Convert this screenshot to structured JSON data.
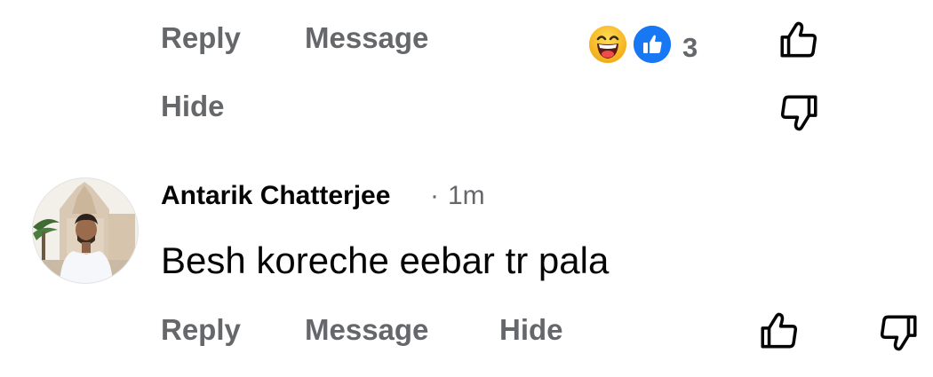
{
  "comment1": {
    "actions": {
      "reply": "Reply",
      "message": "Message",
      "hide": "Hide"
    },
    "reactions": {
      "icons": [
        "laughing-emoji-icon",
        "like-reaction-icon"
      ],
      "count": "3"
    }
  },
  "comment2": {
    "author": "Antarik Chatterjee",
    "separator": "·",
    "time": "1m",
    "text": "Besh koreche eebar tr pala",
    "actions": {
      "reply": "Reply",
      "message": "Message",
      "hide": "Hide"
    }
  },
  "colors": {
    "action_gray": "#65676b",
    "text_black": "#050505",
    "like_blue": "#1877f2",
    "emoji_yellow": "#f7c131"
  }
}
